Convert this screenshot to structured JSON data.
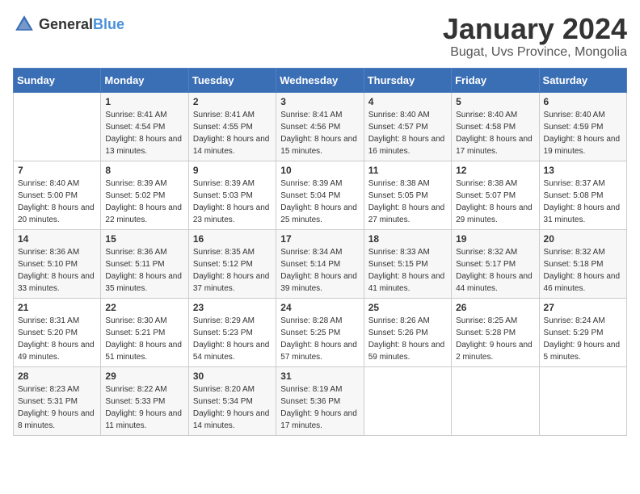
{
  "logo": {
    "text_general": "General",
    "text_blue": "Blue"
  },
  "calendar": {
    "title": "January 2024",
    "subtitle": "Bugat, Uvs Province, Mongolia"
  },
  "weekdays": [
    "Sunday",
    "Monday",
    "Tuesday",
    "Wednesday",
    "Thursday",
    "Friday",
    "Saturday"
  ],
  "weeks": [
    [
      {
        "day": "",
        "sunrise": "",
        "sunset": "",
        "daylight": ""
      },
      {
        "day": "1",
        "sunrise": "Sunrise: 8:41 AM",
        "sunset": "Sunset: 4:54 PM",
        "daylight": "Daylight: 8 hours and 13 minutes."
      },
      {
        "day": "2",
        "sunrise": "Sunrise: 8:41 AM",
        "sunset": "Sunset: 4:55 PM",
        "daylight": "Daylight: 8 hours and 14 minutes."
      },
      {
        "day": "3",
        "sunrise": "Sunrise: 8:41 AM",
        "sunset": "Sunset: 4:56 PM",
        "daylight": "Daylight: 8 hours and 15 minutes."
      },
      {
        "day": "4",
        "sunrise": "Sunrise: 8:40 AM",
        "sunset": "Sunset: 4:57 PM",
        "daylight": "Daylight: 8 hours and 16 minutes."
      },
      {
        "day": "5",
        "sunrise": "Sunrise: 8:40 AM",
        "sunset": "Sunset: 4:58 PM",
        "daylight": "Daylight: 8 hours and 17 minutes."
      },
      {
        "day": "6",
        "sunrise": "Sunrise: 8:40 AM",
        "sunset": "Sunset: 4:59 PM",
        "daylight": "Daylight: 8 hours and 19 minutes."
      }
    ],
    [
      {
        "day": "7",
        "sunrise": "Sunrise: 8:40 AM",
        "sunset": "Sunset: 5:00 PM",
        "daylight": "Daylight: 8 hours and 20 minutes."
      },
      {
        "day": "8",
        "sunrise": "Sunrise: 8:39 AM",
        "sunset": "Sunset: 5:02 PM",
        "daylight": "Daylight: 8 hours and 22 minutes."
      },
      {
        "day": "9",
        "sunrise": "Sunrise: 8:39 AM",
        "sunset": "Sunset: 5:03 PM",
        "daylight": "Daylight: 8 hours and 23 minutes."
      },
      {
        "day": "10",
        "sunrise": "Sunrise: 8:39 AM",
        "sunset": "Sunset: 5:04 PM",
        "daylight": "Daylight: 8 hours and 25 minutes."
      },
      {
        "day": "11",
        "sunrise": "Sunrise: 8:38 AM",
        "sunset": "Sunset: 5:05 PM",
        "daylight": "Daylight: 8 hours and 27 minutes."
      },
      {
        "day": "12",
        "sunrise": "Sunrise: 8:38 AM",
        "sunset": "Sunset: 5:07 PM",
        "daylight": "Daylight: 8 hours and 29 minutes."
      },
      {
        "day": "13",
        "sunrise": "Sunrise: 8:37 AM",
        "sunset": "Sunset: 5:08 PM",
        "daylight": "Daylight: 8 hours and 31 minutes."
      }
    ],
    [
      {
        "day": "14",
        "sunrise": "Sunrise: 8:36 AM",
        "sunset": "Sunset: 5:10 PM",
        "daylight": "Daylight: 8 hours and 33 minutes."
      },
      {
        "day": "15",
        "sunrise": "Sunrise: 8:36 AM",
        "sunset": "Sunset: 5:11 PM",
        "daylight": "Daylight: 8 hours and 35 minutes."
      },
      {
        "day": "16",
        "sunrise": "Sunrise: 8:35 AM",
        "sunset": "Sunset: 5:12 PM",
        "daylight": "Daylight: 8 hours and 37 minutes."
      },
      {
        "day": "17",
        "sunrise": "Sunrise: 8:34 AM",
        "sunset": "Sunset: 5:14 PM",
        "daylight": "Daylight: 8 hours and 39 minutes."
      },
      {
        "day": "18",
        "sunrise": "Sunrise: 8:33 AM",
        "sunset": "Sunset: 5:15 PM",
        "daylight": "Daylight: 8 hours and 41 minutes."
      },
      {
        "day": "19",
        "sunrise": "Sunrise: 8:32 AM",
        "sunset": "Sunset: 5:17 PM",
        "daylight": "Daylight: 8 hours and 44 minutes."
      },
      {
        "day": "20",
        "sunrise": "Sunrise: 8:32 AM",
        "sunset": "Sunset: 5:18 PM",
        "daylight": "Daylight: 8 hours and 46 minutes."
      }
    ],
    [
      {
        "day": "21",
        "sunrise": "Sunrise: 8:31 AM",
        "sunset": "Sunset: 5:20 PM",
        "daylight": "Daylight: 8 hours and 49 minutes."
      },
      {
        "day": "22",
        "sunrise": "Sunrise: 8:30 AM",
        "sunset": "Sunset: 5:21 PM",
        "daylight": "Daylight: 8 hours and 51 minutes."
      },
      {
        "day": "23",
        "sunrise": "Sunrise: 8:29 AM",
        "sunset": "Sunset: 5:23 PM",
        "daylight": "Daylight: 8 hours and 54 minutes."
      },
      {
        "day": "24",
        "sunrise": "Sunrise: 8:28 AM",
        "sunset": "Sunset: 5:25 PM",
        "daylight": "Daylight: 8 hours and 57 minutes."
      },
      {
        "day": "25",
        "sunrise": "Sunrise: 8:26 AM",
        "sunset": "Sunset: 5:26 PM",
        "daylight": "Daylight: 8 hours and 59 minutes."
      },
      {
        "day": "26",
        "sunrise": "Sunrise: 8:25 AM",
        "sunset": "Sunset: 5:28 PM",
        "daylight": "Daylight: 9 hours and 2 minutes."
      },
      {
        "day": "27",
        "sunrise": "Sunrise: 8:24 AM",
        "sunset": "Sunset: 5:29 PM",
        "daylight": "Daylight: 9 hours and 5 minutes."
      }
    ],
    [
      {
        "day": "28",
        "sunrise": "Sunrise: 8:23 AM",
        "sunset": "Sunset: 5:31 PM",
        "daylight": "Daylight: 9 hours and 8 minutes."
      },
      {
        "day": "29",
        "sunrise": "Sunrise: 8:22 AM",
        "sunset": "Sunset: 5:33 PM",
        "daylight": "Daylight: 9 hours and 11 minutes."
      },
      {
        "day": "30",
        "sunrise": "Sunrise: 8:20 AM",
        "sunset": "Sunset: 5:34 PM",
        "daylight": "Daylight: 9 hours and 14 minutes."
      },
      {
        "day": "31",
        "sunrise": "Sunrise: 8:19 AM",
        "sunset": "Sunset: 5:36 PM",
        "daylight": "Daylight: 9 hours and 17 minutes."
      },
      {
        "day": "",
        "sunrise": "",
        "sunset": "",
        "daylight": ""
      },
      {
        "day": "",
        "sunrise": "",
        "sunset": "",
        "daylight": ""
      },
      {
        "day": "",
        "sunrise": "",
        "sunset": "",
        "daylight": ""
      }
    ]
  ]
}
